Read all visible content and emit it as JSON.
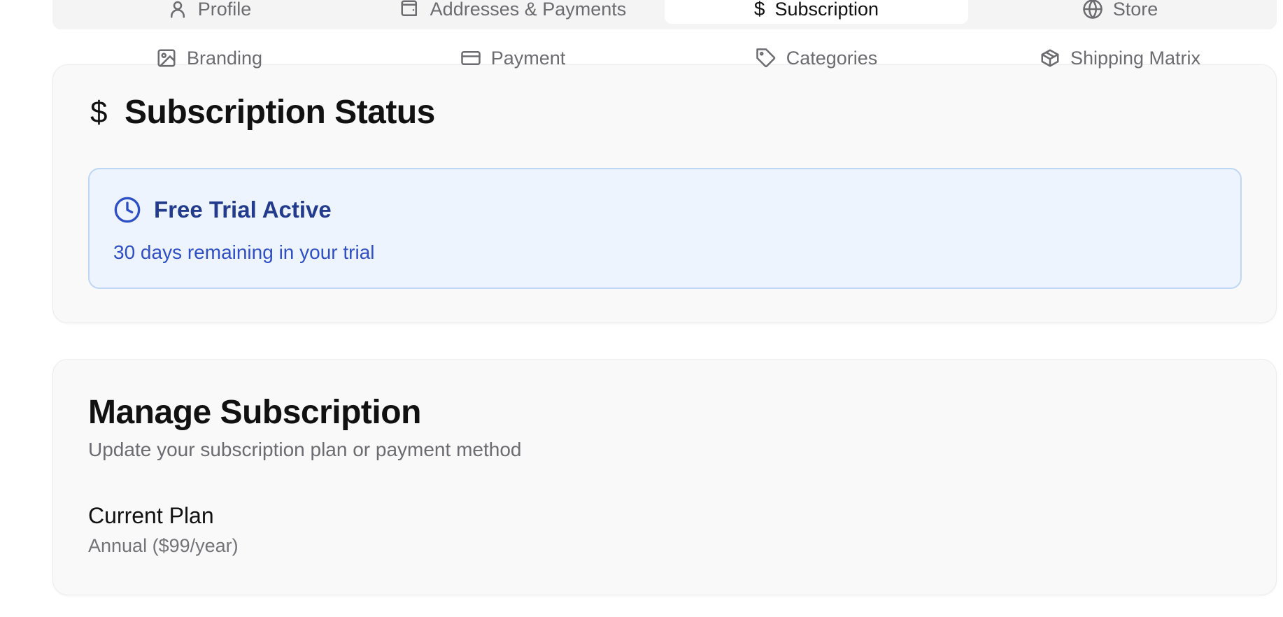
{
  "tabs_primary": [
    {
      "label": "Profile",
      "icon": "user-icon",
      "active": false
    },
    {
      "label": "Addresses & Payments",
      "icon": "wallet-icon",
      "active": false
    },
    {
      "label": "Subscription",
      "icon": "dollar-icon",
      "active": true
    },
    {
      "label": "Store",
      "icon": "globe-icon",
      "active": false
    }
  ],
  "tabs_secondary": [
    {
      "label": "Branding",
      "icon": "image-icon"
    },
    {
      "label": "Payment",
      "icon": "credit-card-icon"
    },
    {
      "label": "Categories",
      "icon": "tag-icon"
    },
    {
      "label": "Shipping Matrix",
      "icon": "package-icon"
    }
  ],
  "status_card": {
    "title": "Subscription Status",
    "icon": "dollar-icon",
    "trial": {
      "heading": "Free Trial Active",
      "icon": "clock-icon",
      "message": "30 days remaining in your trial"
    }
  },
  "manage_card": {
    "title": "Manage Subscription",
    "subtitle": "Update your subscription plan or payment method",
    "plan_label": "Current Plan",
    "plan_value": "Annual ($99/year)"
  },
  "colors": {
    "trial_bg": "#eef4fd",
    "trial_border": "#bed7f7",
    "trial_heading": "#233b8c",
    "trial_text": "#2e4fc6"
  }
}
